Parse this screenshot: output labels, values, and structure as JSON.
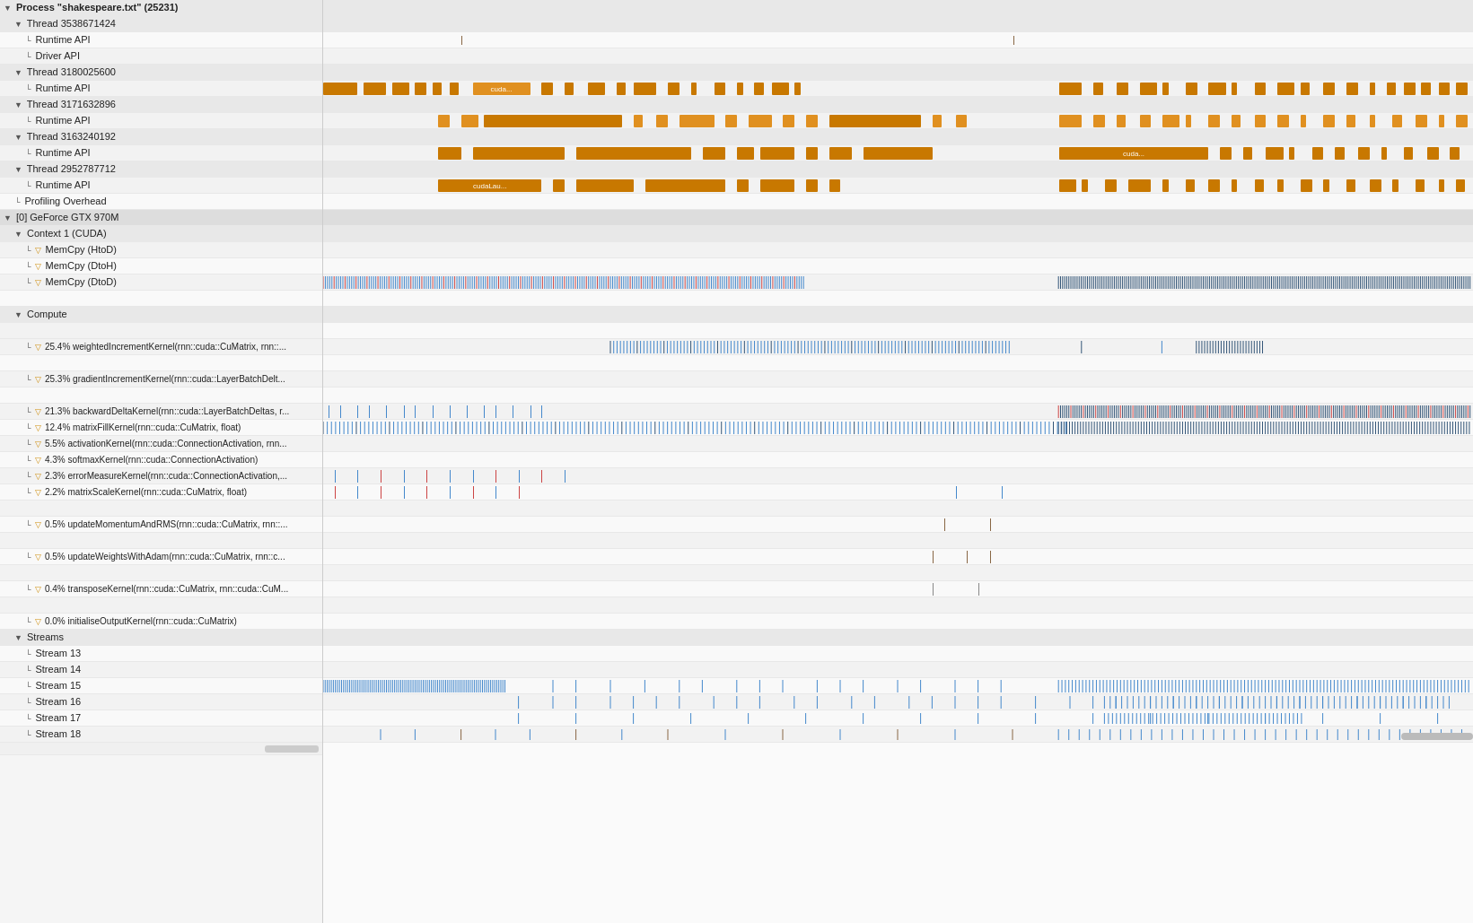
{
  "leftPanel": {
    "rows": [
      {
        "id": "process",
        "label": "Process \"shakespeare.txt\" (25231)",
        "indent": 0,
        "type": "header",
        "collapsed": false
      },
      {
        "id": "thread1",
        "label": "Thread 3538671424",
        "indent": 1,
        "type": "section",
        "collapsed": false
      },
      {
        "id": "runtime-api-1",
        "label": "Runtime API",
        "indent": 2,
        "type": "normal"
      },
      {
        "id": "driver-api-1",
        "label": "Driver API",
        "indent": 2,
        "type": "normal"
      },
      {
        "id": "thread2",
        "label": "Thread 3180025600",
        "indent": 1,
        "type": "section",
        "collapsed": false
      },
      {
        "id": "runtime-api-2",
        "label": "Runtime API",
        "indent": 2,
        "type": "normal"
      },
      {
        "id": "thread3",
        "label": "Thread 3171632896",
        "indent": 1,
        "type": "section",
        "collapsed": false
      },
      {
        "id": "runtime-api-3",
        "label": "Runtime API",
        "indent": 2,
        "type": "normal"
      },
      {
        "id": "thread4",
        "label": "Thread 3163240192",
        "indent": 1,
        "type": "section",
        "collapsed": false
      },
      {
        "id": "runtime-api-4",
        "label": "Runtime API",
        "indent": 2,
        "type": "normal"
      },
      {
        "id": "thread5",
        "label": "Thread 2952787712",
        "indent": 1,
        "type": "section",
        "collapsed": false
      },
      {
        "id": "runtime-api-5",
        "label": "Runtime API",
        "indent": 2,
        "type": "normal"
      },
      {
        "id": "profiling-overhead",
        "label": "Profiling Overhead",
        "indent": 1,
        "type": "normal"
      },
      {
        "id": "gpu",
        "label": "[0] GeForce GTX 970M",
        "indent": 0,
        "type": "section",
        "collapsed": false
      },
      {
        "id": "context",
        "label": "Context 1 (CUDA)",
        "indent": 1,
        "type": "section",
        "collapsed": false
      },
      {
        "id": "memcpy-htod",
        "label": "MemCpy (HtoD)",
        "indent": 2,
        "type": "normal",
        "hasIcon": true
      },
      {
        "id": "memcpy-dtoh",
        "label": "MemCpy (DtoH)",
        "indent": 2,
        "type": "normal",
        "hasIcon": true
      },
      {
        "id": "memcpy-dtod",
        "label": "MemCpy (DtoD)",
        "indent": 2,
        "type": "normal",
        "hasIcon": true
      },
      {
        "id": "spacer1",
        "label": "",
        "indent": 0,
        "type": "spacer"
      },
      {
        "id": "compute",
        "label": "Compute",
        "indent": 1,
        "type": "section",
        "collapsed": false
      },
      {
        "id": "spacer2",
        "label": "",
        "indent": 0,
        "type": "spacer"
      },
      {
        "id": "kernel1",
        "label": "25.4% weightedIncrementKernel(rnn::cuda::CuMatrix, rnn::...",
        "indent": 2,
        "type": "normal",
        "hasIcon": true
      },
      {
        "id": "spacer3",
        "label": "",
        "indent": 0,
        "type": "spacer"
      },
      {
        "id": "kernel2",
        "label": "25.3% gradientIncrementKernel(rnn::cuda::LayerBatchDelt...",
        "indent": 2,
        "type": "normal",
        "hasIcon": true
      },
      {
        "id": "spacer4",
        "label": "",
        "indent": 0,
        "type": "spacer"
      },
      {
        "id": "kernel3",
        "label": "21.3% backwardDeltaKernel(rnn::cuda::LayerBatchDeltas, r...",
        "indent": 2,
        "type": "normal",
        "hasIcon": true
      },
      {
        "id": "kernel4",
        "label": "12.4% matrixFillKernel(rnn::cuda::CuMatrix, float)",
        "indent": 2,
        "type": "normal",
        "hasIcon": true
      },
      {
        "id": "kernel5",
        "label": "5.5% activationKernel(rnn::cuda::ConnectionActivation, rnn...",
        "indent": 2,
        "type": "normal",
        "hasIcon": true
      },
      {
        "id": "kernel6",
        "label": "4.3% softmaxKernel(rnn::cuda::ConnectionActivation)",
        "indent": 2,
        "type": "normal",
        "hasIcon": true
      },
      {
        "id": "kernel7",
        "label": "2.3% errorMeasureKernel(rnn::cuda::ConnectionActivation,...",
        "indent": 2,
        "type": "normal",
        "hasIcon": true
      },
      {
        "id": "kernel8",
        "label": "2.2% matrixScaleKernel(rnn::cuda::CuMatrix, float)",
        "indent": 2,
        "type": "normal",
        "hasIcon": true
      },
      {
        "id": "spacer5",
        "label": "",
        "indent": 0,
        "type": "spacer"
      },
      {
        "id": "kernel9",
        "label": "0.5% updateMomentumAndRMS(rnn::cuda::CuMatrix, rnn::...",
        "indent": 2,
        "type": "normal",
        "hasIcon": true
      },
      {
        "id": "spacer6",
        "label": "",
        "indent": 0,
        "type": "spacer"
      },
      {
        "id": "kernel10",
        "label": "0.5% updateWeightsWithAdam(rnn::cuda::CuMatrix, rnn::c...",
        "indent": 2,
        "type": "normal",
        "hasIcon": true
      },
      {
        "id": "spacer7",
        "label": "",
        "indent": 0,
        "type": "spacer"
      },
      {
        "id": "kernel11",
        "label": "0.4% transposeKernel(rnn::cuda::CuMatrix, rnn::cuda::CuM...",
        "indent": 2,
        "type": "normal",
        "hasIcon": true
      },
      {
        "id": "spacer8",
        "label": "",
        "indent": 0,
        "type": "spacer"
      },
      {
        "id": "kernel12",
        "label": "0.0% initialiseOutputKernel(rnn::cuda::CuMatrix)",
        "indent": 2,
        "type": "normal",
        "hasIcon": true
      },
      {
        "id": "streams",
        "label": "Streams",
        "indent": 1,
        "type": "section",
        "collapsed": false
      },
      {
        "id": "stream13",
        "label": "Stream 13",
        "indent": 2,
        "type": "normal"
      },
      {
        "id": "stream14",
        "label": "Stream 14",
        "indent": 2,
        "type": "normal"
      },
      {
        "id": "stream15",
        "label": "Stream 15",
        "indent": 2,
        "type": "normal"
      },
      {
        "id": "stream16",
        "label": "Stream 16",
        "indent": 2,
        "type": "normal"
      },
      {
        "id": "stream17",
        "label": "Stream 17",
        "indent": 2,
        "type": "normal"
      },
      {
        "id": "stream18",
        "label": "Stream 18",
        "indent": 2,
        "type": "normal"
      }
    ]
  },
  "colors": {
    "orange": "#c87800",
    "blue": "#4488cc",
    "teal": "#2288aa",
    "red": "#cc4444",
    "brown": "#886644",
    "background_dark": "#ddd",
    "background_mid": "#e8e8e8"
  }
}
